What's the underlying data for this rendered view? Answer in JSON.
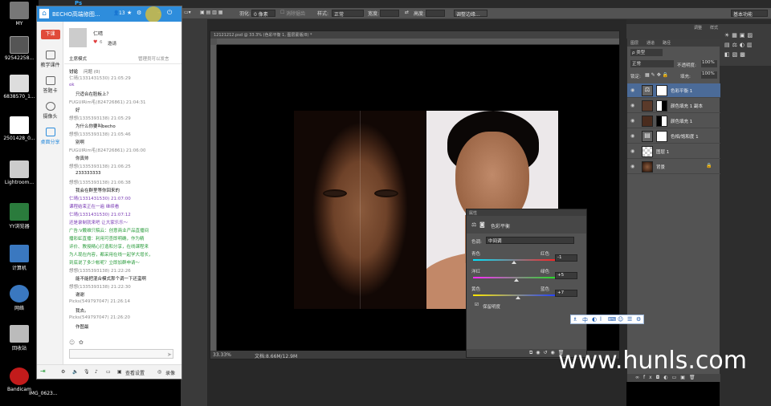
{
  "desktop": {
    "icons": [
      {
        "label": "MY"
      },
      {
        "label": "92542258..."
      },
      {
        "label": "6838570_1..."
      },
      {
        "label": "2501428_0..."
      },
      {
        "label": "Lightroom..."
      },
      {
        "label": "YY浏览器"
      },
      {
        "label": "计算机"
      },
      {
        "label": "网络"
      },
      {
        "label": "回收站"
      },
      {
        "label": "Bandicam"
      }
    ],
    "taskbar_file": "IMG_0623..."
  },
  "photoshop": {
    "app_label": "Ps",
    "options": {
      "feather_label": "羽化:",
      "feather_value": "0 像素",
      "antialias_label": "消除锯齿",
      "style_label": "样式:",
      "style_value": "正常",
      "width_label": "宽度:",
      "height_label": "高度:",
      "refine_button": "调整边缘...",
      "workspace": "基本功能"
    },
    "document": {
      "tab_title": "12121212.psd @ 33.3% (色彩平衡 1, 图层蒙版/8) *",
      "zoom": "33.33%",
      "doc_size": "文档:8.66M/12.9M"
    },
    "layers_panel": {
      "tabs": [
        "图层",
        "通道",
        "路径"
      ],
      "kind_label": "ρ 类型",
      "blend_mode": "正常",
      "opacity_label": "不透明度:",
      "opacity_value": "100%",
      "lock_label": "锁定:",
      "fill_label": "填充:",
      "fill_value": "100%",
      "layers": [
        {
          "name": "色彩平衡 1",
          "selected": true
        },
        {
          "name": "颜色填充 1 副本",
          "selected": false
        },
        {
          "name": "颜色填充 1",
          "selected": false
        },
        {
          "name": "色相/饱和度 1",
          "selected": false
        },
        {
          "name": "图层 1",
          "selected": false
        },
        {
          "name": "背景",
          "selected": false
        }
      ]
    },
    "adjust_tabs": [
      "调整",
      "样式"
    ],
    "properties": {
      "header": "属性",
      "title": "色彩平衡",
      "tone_label": "色调:",
      "tone_value": "中间调",
      "rows": [
        {
          "left": "青色",
          "right": "红色",
          "value": "-1"
        },
        {
          "left": "洋红",
          "right": "绿色",
          "value": "+5"
        },
        {
          "left": "黄色",
          "right": "蓝色",
          "value": "+7"
        }
      ],
      "preserve_label": "保留明度"
    }
  },
  "ime": {
    "items": [
      "中",
      "◐",
      "ⅼ",
      "⌨",
      "☺",
      "☰",
      "⚙"
    ]
  },
  "watermark": "www.hunls.com",
  "chat": {
    "title": "BECHO高端修图...",
    "member_count": "13",
    "sidebar": [
      {
        "label": "下课"
      },
      {
        "label": "教学课件"
      },
      {
        "label": "答题卡"
      },
      {
        "label": "摄像头"
      },
      {
        "label": "桌面分享"
      }
    ],
    "teacher": {
      "name": "仁晴",
      "likes": "6",
      "invite": "邀请"
    },
    "mode_label": "主席模式",
    "mode_hint": "管理员可以发言",
    "discuss_label": "讨论",
    "question_label": "问题 (0)",
    "messages": [
      {
        "text": "仁晴(1331431530) 21:05:29",
        "kind": "meta"
      },
      {
        "text": "ok",
        "kind": "purple"
      },
      {
        "text": "只适合在脸板上？",
        "kind": "body"
      },
      {
        "text": "FUGUIRim毛(824726861) 21:04:31",
        "kind": "meta"
      },
      {
        "text": "好",
        "kind": "body"
      },
      {
        "text": "想想(1335393138) 21:05:29",
        "kind": "meta"
      },
      {
        "text": "为什么你要叫becho",
        "kind": "body"
      },
      {
        "text": "想想(1335393138) 21:05:46",
        "kind": "meta"
      },
      {
        "text": "别啊",
        "kind": "body"
      },
      {
        "text": "FUGUIRim毛(824726861) 21:06:00",
        "kind": "meta"
      },
      {
        "text": "你真帅",
        "kind": "body"
      },
      {
        "text": "想想(1335393138) 21:06:25",
        "kind": "meta"
      },
      {
        "text": "233333333",
        "kind": "body"
      },
      {
        "text": "想想(1335393138) 21:06:38",
        "kind": "meta"
      },
      {
        "text": "我会在群里等你回来的",
        "kind": "body"
      },
      {
        "text": "仁晴(1331431530) 21:07:00",
        "kind": "purple"
      },
      {
        "text": "课程结束正在一遍 继续看",
        "kind": "purple"
      },
      {
        "text": "仁晴(1331431530) 21:07:12",
        "kind": "purple"
      },
      {
        "text": "还是录制就来吧 让大家乐乐～",
        "kind": "purple"
      },
      {
        "text": "广告:V戴维只稿云：创意商业产品直播间",
        "kind": "green"
      },
      {
        "text": "播彩虹直播：利用可查即明确，作为精",
        "kind": "green"
      },
      {
        "text": "评价、教授精心打造和分享，在线课程来",
        "kind": "green"
      },
      {
        "text": "为人现在内容，都采用在线一起学大增长，",
        "kind": "green"
      },
      {
        "text": "到底说了多少帐呢？立即加群申请～",
        "kind": "green"
      },
      {
        "text": "想想(1335393138) 21:22:26",
        "kind": "meta"
      },
      {
        "text": "能不能把混合模式那个调一下还蛮啊",
        "kind": "body"
      },
      {
        "text": "想想(1335393138) 21:22:30",
        "kind": "meta"
      },
      {
        "text": "谢谢",
        "kind": "body"
      },
      {
        "text": "Picks(549797047) 21:26:14",
        "kind": "meta"
      },
      {
        "text": "我去。",
        "kind": "body"
      },
      {
        "text": "Picks(549797047) 21:26:20",
        "kind": "meta"
      },
      {
        "text": "作图最",
        "kind": "body"
      }
    ],
    "bottom": {
      "screen_label": "查看设置",
      "record_label": "录像"
    }
  }
}
